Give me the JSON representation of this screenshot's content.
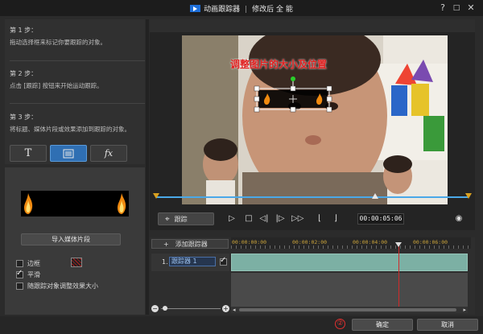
{
  "window": {
    "title": "动画跟踪器",
    "subtitle": "修改后 全 能",
    "help_label": "?",
    "minimize_label": "□",
    "close_label": "✕"
  },
  "steps": [
    {
      "heading": "第 1 步：",
      "desc": "拖动选择框来标记你要跟踪的对象。"
    },
    {
      "heading": "第 2 步：",
      "desc": "点击 [跟踪] 按钮来开始运动跟踪。"
    },
    {
      "heading": "第 3 步：",
      "desc": "将标题、媒体片段或效果添加到跟踪的对象。"
    }
  ],
  "mode_buttons": [
    {
      "label": "T",
      "icon": "title-icon",
      "active": false
    },
    {
      "label": "",
      "icon": "media-icon",
      "active": true
    },
    {
      "label": "fx",
      "icon": "effect-icon",
      "active": false
    }
  ],
  "import_button": "导入媒体片段",
  "options": [
    {
      "label": "边框",
      "checked": false
    },
    {
      "label": "平滑",
      "checked": true
    },
    {
      "label": "随跟踪对象调整效果大小",
      "checked": false
    }
  ],
  "preview": {
    "overlay_text": "调整图片的大小及位置"
  },
  "controls": {
    "track_label": "跟踪",
    "timecode": "00:00:05:06"
  },
  "timeline": {
    "add_tracker_label": "添加跟踪器",
    "ticks": [
      "00:00:00:00",
      "00:00:02:00",
      "00:00:04:00",
      "00:00:06:00"
    ],
    "track_number": "1.",
    "track_name": "跟踪器 1",
    "track_checked": true
  },
  "footer": {
    "marker": "②",
    "ok_label": "确定",
    "cancel_label": "取消"
  },
  "colors": {
    "accent": "#2f6fb3",
    "clip": "#7cb0a4",
    "playhead": "#d02a2a",
    "overlay_text": "#e02020"
  }
}
